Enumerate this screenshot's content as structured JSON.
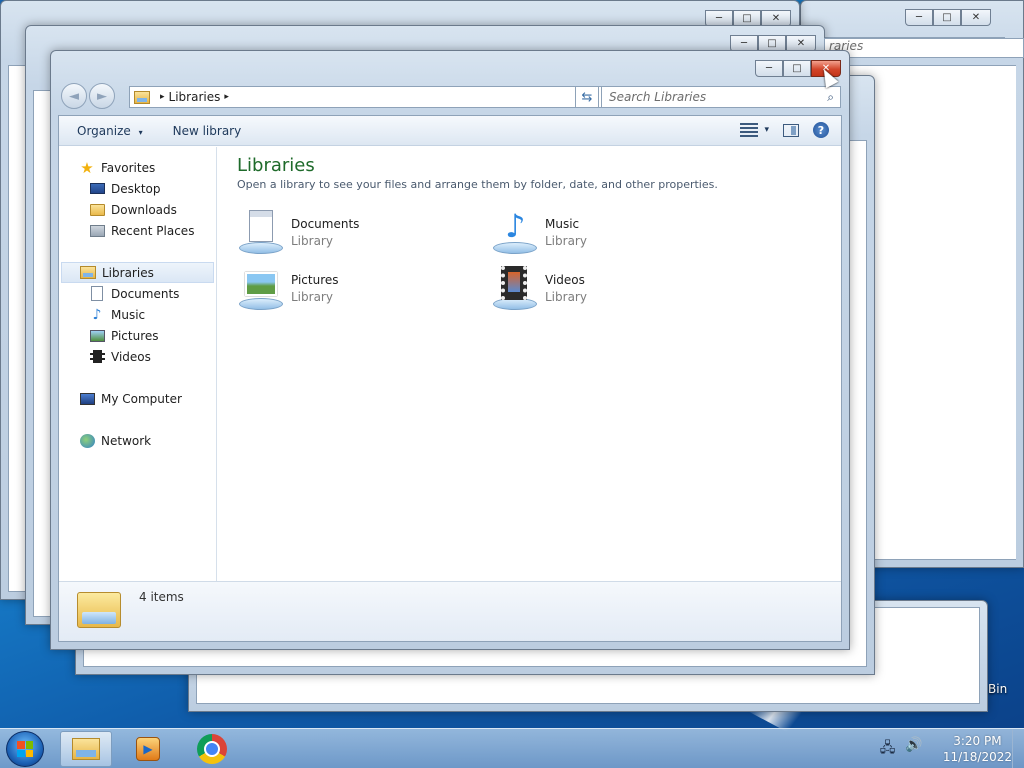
{
  "window": {
    "title": "Libraries",
    "caption": {
      "minimize": "─",
      "maximize": "□",
      "close": "✕"
    }
  },
  "navbar": {
    "back": "◄",
    "forward": "►",
    "address": {
      "sep": "▸",
      "path": "Libraries",
      "trail": "▸",
      "dropdown": "▾"
    },
    "refresh": "⇆",
    "search_placeholder": "Search Libraries",
    "search_icon": "⌕"
  },
  "commands": {
    "organize": "Organize",
    "organize_caret": "▾",
    "new_library": "New library",
    "view_caret": "▾",
    "help": "?"
  },
  "nav_pane": {
    "favorites": "Favorites",
    "favorites_items": [
      "Desktop",
      "Downloads",
      "Recent Places"
    ],
    "libraries": "Libraries",
    "libraries_items": [
      "Documents",
      "Music",
      "Pictures",
      "Videos"
    ],
    "computer": "My Computer",
    "network": "Network"
  },
  "content": {
    "title": "Libraries",
    "subtitle": "Open a library to see your files and arrange them by folder, date, and other properties.",
    "tiles": [
      {
        "name": "Documents",
        "type": "Library",
        "icon": "documents-library-icon"
      },
      {
        "name": "Music",
        "type": "Library",
        "icon": "music-library-icon"
      },
      {
        "name": "Pictures",
        "type": "Library",
        "icon": "pictures-library-icon"
      },
      {
        "name": "Videos",
        "type": "Library",
        "icon": "videos-library-icon"
      }
    ]
  },
  "details": {
    "count": "4 items"
  },
  "background_windows": {
    "search_fragment": "raries"
  },
  "desktop": {
    "recycle_label": "Bin"
  },
  "taskbar": {
    "time": "3:20 PM",
    "date": "11/18/2022",
    "tray_network": "🖧",
    "tray_volume": "🔊"
  }
}
